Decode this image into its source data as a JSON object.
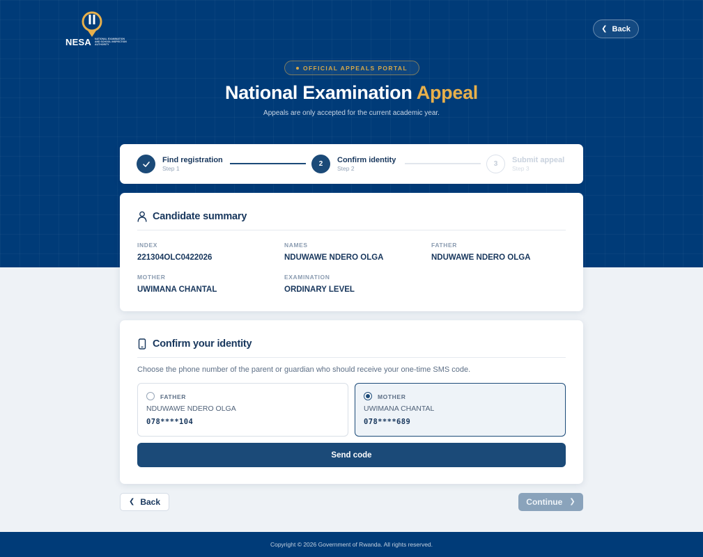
{
  "brand": {
    "logo_text": "NESA",
    "logo_subtext": "NATIONAL EXAMINATION AND SCHOOL INSPECTION AUTHORITY",
    "accent_color": "#e8b04b",
    "primary_color": "#003b78",
    "button_color": "#1b4a78"
  },
  "header": {
    "back_label": "Back",
    "badge": "OFFICIAL APPEALS PORTAL",
    "title_main": "National Examination",
    "title_accent": "Appeal",
    "subtitle": "Appeals are only accepted for the current academic year."
  },
  "stepper": {
    "steps": [
      {
        "number": "1",
        "label": "Find registration",
        "sublabel": "Step 1",
        "status": "complete",
        "icon": "check-icon"
      },
      {
        "number": "2",
        "label": "Confirm identity",
        "sublabel": "Step 2",
        "status": "active"
      },
      {
        "number": "3",
        "label": "Submit appeal",
        "sublabel": "Step 3",
        "status": "pending"
      }
    ]
  },
  "summary": {
    "title": "Candidate summary",
    "icon": "user-icon",
    "fields": [
      {
        "label": "INDEX",
        "value": "221304OLC0422026"
      },
      {
        "label": "NAMES",
        "value": "NDUWAWE NDERO OLGA"
      },
      {
        "label": "FATHER",
        "value": "NDUWAWE NDERO OLGA"
      },
      {
        "label": "MOTHER",
        "value": "UWIMANA CHANTAL"
      },
      {
        "label": "EXAMINATION",
        "value": "ORDINARY LEVEL"
      }
    ]
  },
  "identity": {
    "title": "Confirm your identity",
    "icon": "phone-icon",
    "instruction": "Choose the phone number of the parent or guardian who should receive your one-time SMS code.",
    "options": [
      {
        "role": "FATHER",
        "name": "NDUWAWE NDERO OLGA",
        "phone": "078****104",
        "selected": false
      },
      {
        "role": "MOTHER",
        "name": "UWIMANA CHANTAL",
        "phone": "078****689",
        "selected": true
      }
    ],
    "send_label": "Send code"
  },
  "nav": {
    "back_label": "Back",
    "continue_label": "Continue"
  },
  "footer": {
    "text": "Copyright © 2026 Government of Rwanda. All rights reserved."
  }
}
